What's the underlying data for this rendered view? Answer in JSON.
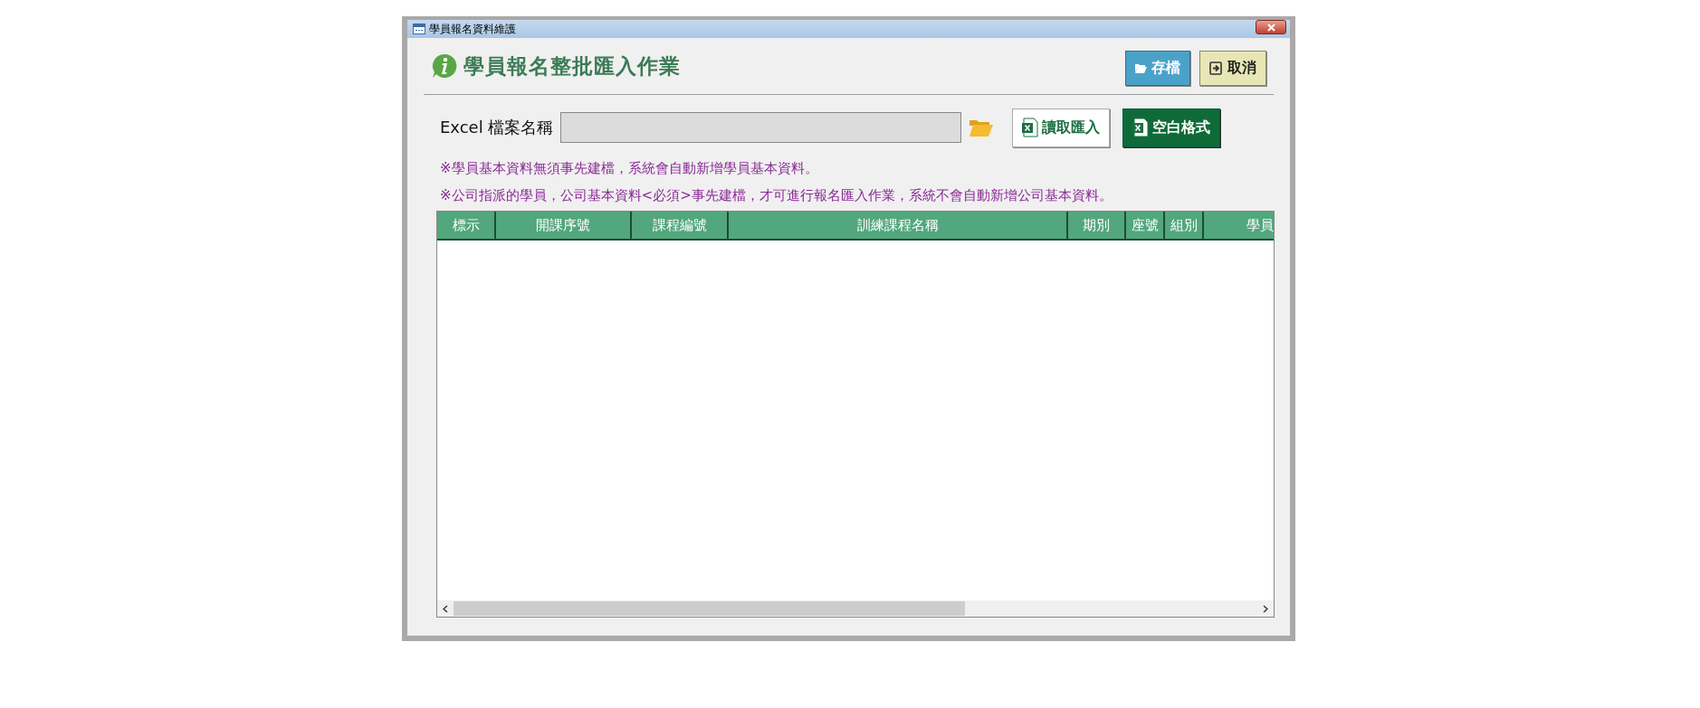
{
  "window": {
    "title": "學員報名資料維護"
  },
  "heading": "學員報名整批匯入作業",
  "toolbar_buttons": [
    {
      "label": "存檔",
      "kind": "save"
    },
    {
      "label": "取消",
      "kind": "cancel"
    }
  ],
  "file_field": {
    "label": "Excel 檔案名稱"
  },
  "import_buttons": [
    {
      "label": "讀取匯入",
      "kind": "read"
    },
    {
      "label": "空白格式",
      "kind": "blank"
    }
  ],
  "notes": [
    "※學員基本資料無須事先建檔，系統會自動新增學員基本資料。",
    "※公司指派的學員，公司基本資料<必須>事先建檔，才可進行報名匯入作業，系統不會自動新增公司基本資料。"
  ],
  "table": {
    "columns": [
      "標示",
      "開課序號",
      "課程編號",
      "訓練課程名稱",
      "期別",
      "座號",
      "組別",
      "學員"
    ]
  }
}
